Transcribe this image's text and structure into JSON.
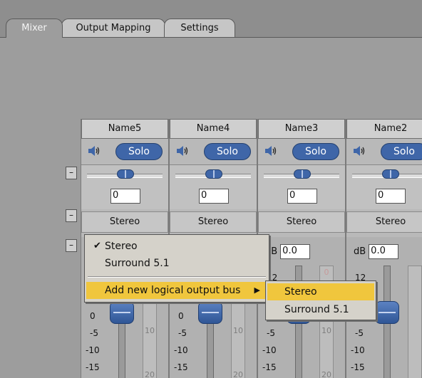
{
  "tabs": [
    {
      "label": "Mixer",
      "active": true
    },
    {
      "label": "Output Mapping",
      "active": false
    },
    {
      "label": "Settings",
      "active": false
    }
  ],
  "collapse_symbol": "–",
  "channels": [
    {
      "name": "Name5",
      "solo": "Solo",
      "pan": "0",
      "output": "Stereo"
    },
    {
      "name": "Name4",
      "solo": "Solo",
      "pan": "0",
      "output": "Stereo"
    },
    {
      "name": "Name3",
      "solo": "Solo",
      "pan": "0",
      "output": "Stereo",
      "db_label": "dB",
      "db_value": "0.0"
    },
    {
      "name": "Name2",
      "solo": "Solo",
      "pan": "0",
      "output": "Stereo",
      "db_label": "dB",
      "db_value": "0.0"
    }
  ],
  "fader_scale": [
    "12",
    "0",
    "-5",
    "-10",
    "-15"
  ],
  "meter_scale": [
    "0",
    "10",
    "20"
  ],
  "context_menu": {
    "items": [
      "Stereo",
      "Surround 5.1",
      "Add new logical output bus"
    ],
    "checked": "Stereo",
    "highlighted": "Add new logical output bus"
  },
  "submenu": {
    "items": [
      "Stereo",
      "Surround 5.1"
    ],
    "highlighted": "Stereo"
  },
  "colors": {
    "accent": "#3f66a8",
    "highlight": "#f0c63d",
    "background": "#9d9d9d"
  },
  "icons": {
    "speaker": "speaker-icon",
    "check": "checkmark-icon",
    "submenu_arrow": "triangle-right-icon"
  }
}
